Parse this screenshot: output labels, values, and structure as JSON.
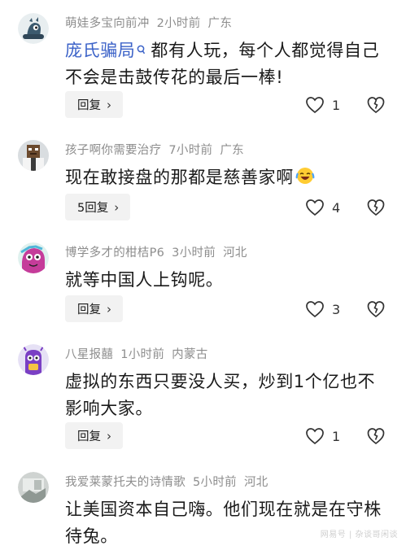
{
  "comments": [
    {
      "username": "萌娃多宝向前冲",
      "time": "2小时前",
      "location": "广东",
      "reply_to": "庞氏骗局",
      "text_line1": "都有人玩，每个人都觉得自己",
      "text_line2": "不会是击鼓传花的最后一棒!",
      "reply_label": "回复",
      "likes": "1"
    },
    {
      "username": "孩子啊你需要治疗",
      "time": "7小时前",
      "location": "广东",
      "text_line1": "现在敢接盘的那都是慈善家啊",
      "emoji": "laughing-crying-emoji",
      "reply_label": "5回复",
      "likes": "4"
    },
    {
      "username": "博学多才的柑桔P6",
      "time": "3小时前",
      "location": "河北",
      "text_line1": "就等中国人上钩呢。",
      "reply_label": "回复",
      "likes": "3"
    },
    {
      "username": "八星报囍",
      "time": "1小时前",
      "location": "内蒙古",
      "text_line1": "虚拟的东西只要没人买，炒到1个亿也不",
      "text_line2": "影响大家。",
      "reply_label": "回复",
      "likes": "1"
    },
    {
      "username": "我爱莱蒙托夫的诗情歌",
      "time": "5小时前",
      "location": "河北",
      "text_line1": "让美国资本自己嗨。他们现在就是在守株",
      "text_line2": "待兔。"
    }
  ],
  "icons": {
    "like": "heart-outline-icon",
    "dislike": "broken-heart-icon",
    "reply_chevron": "chevron-right-icon"
  },
  "colors": {
    "link": "#3b62c8",
    "meta": "#8d8d8d",
    "reply_bg": "#f2f2f2"
  },
  "watermark": "网易号 | 杂谈哥闲谈"
}
